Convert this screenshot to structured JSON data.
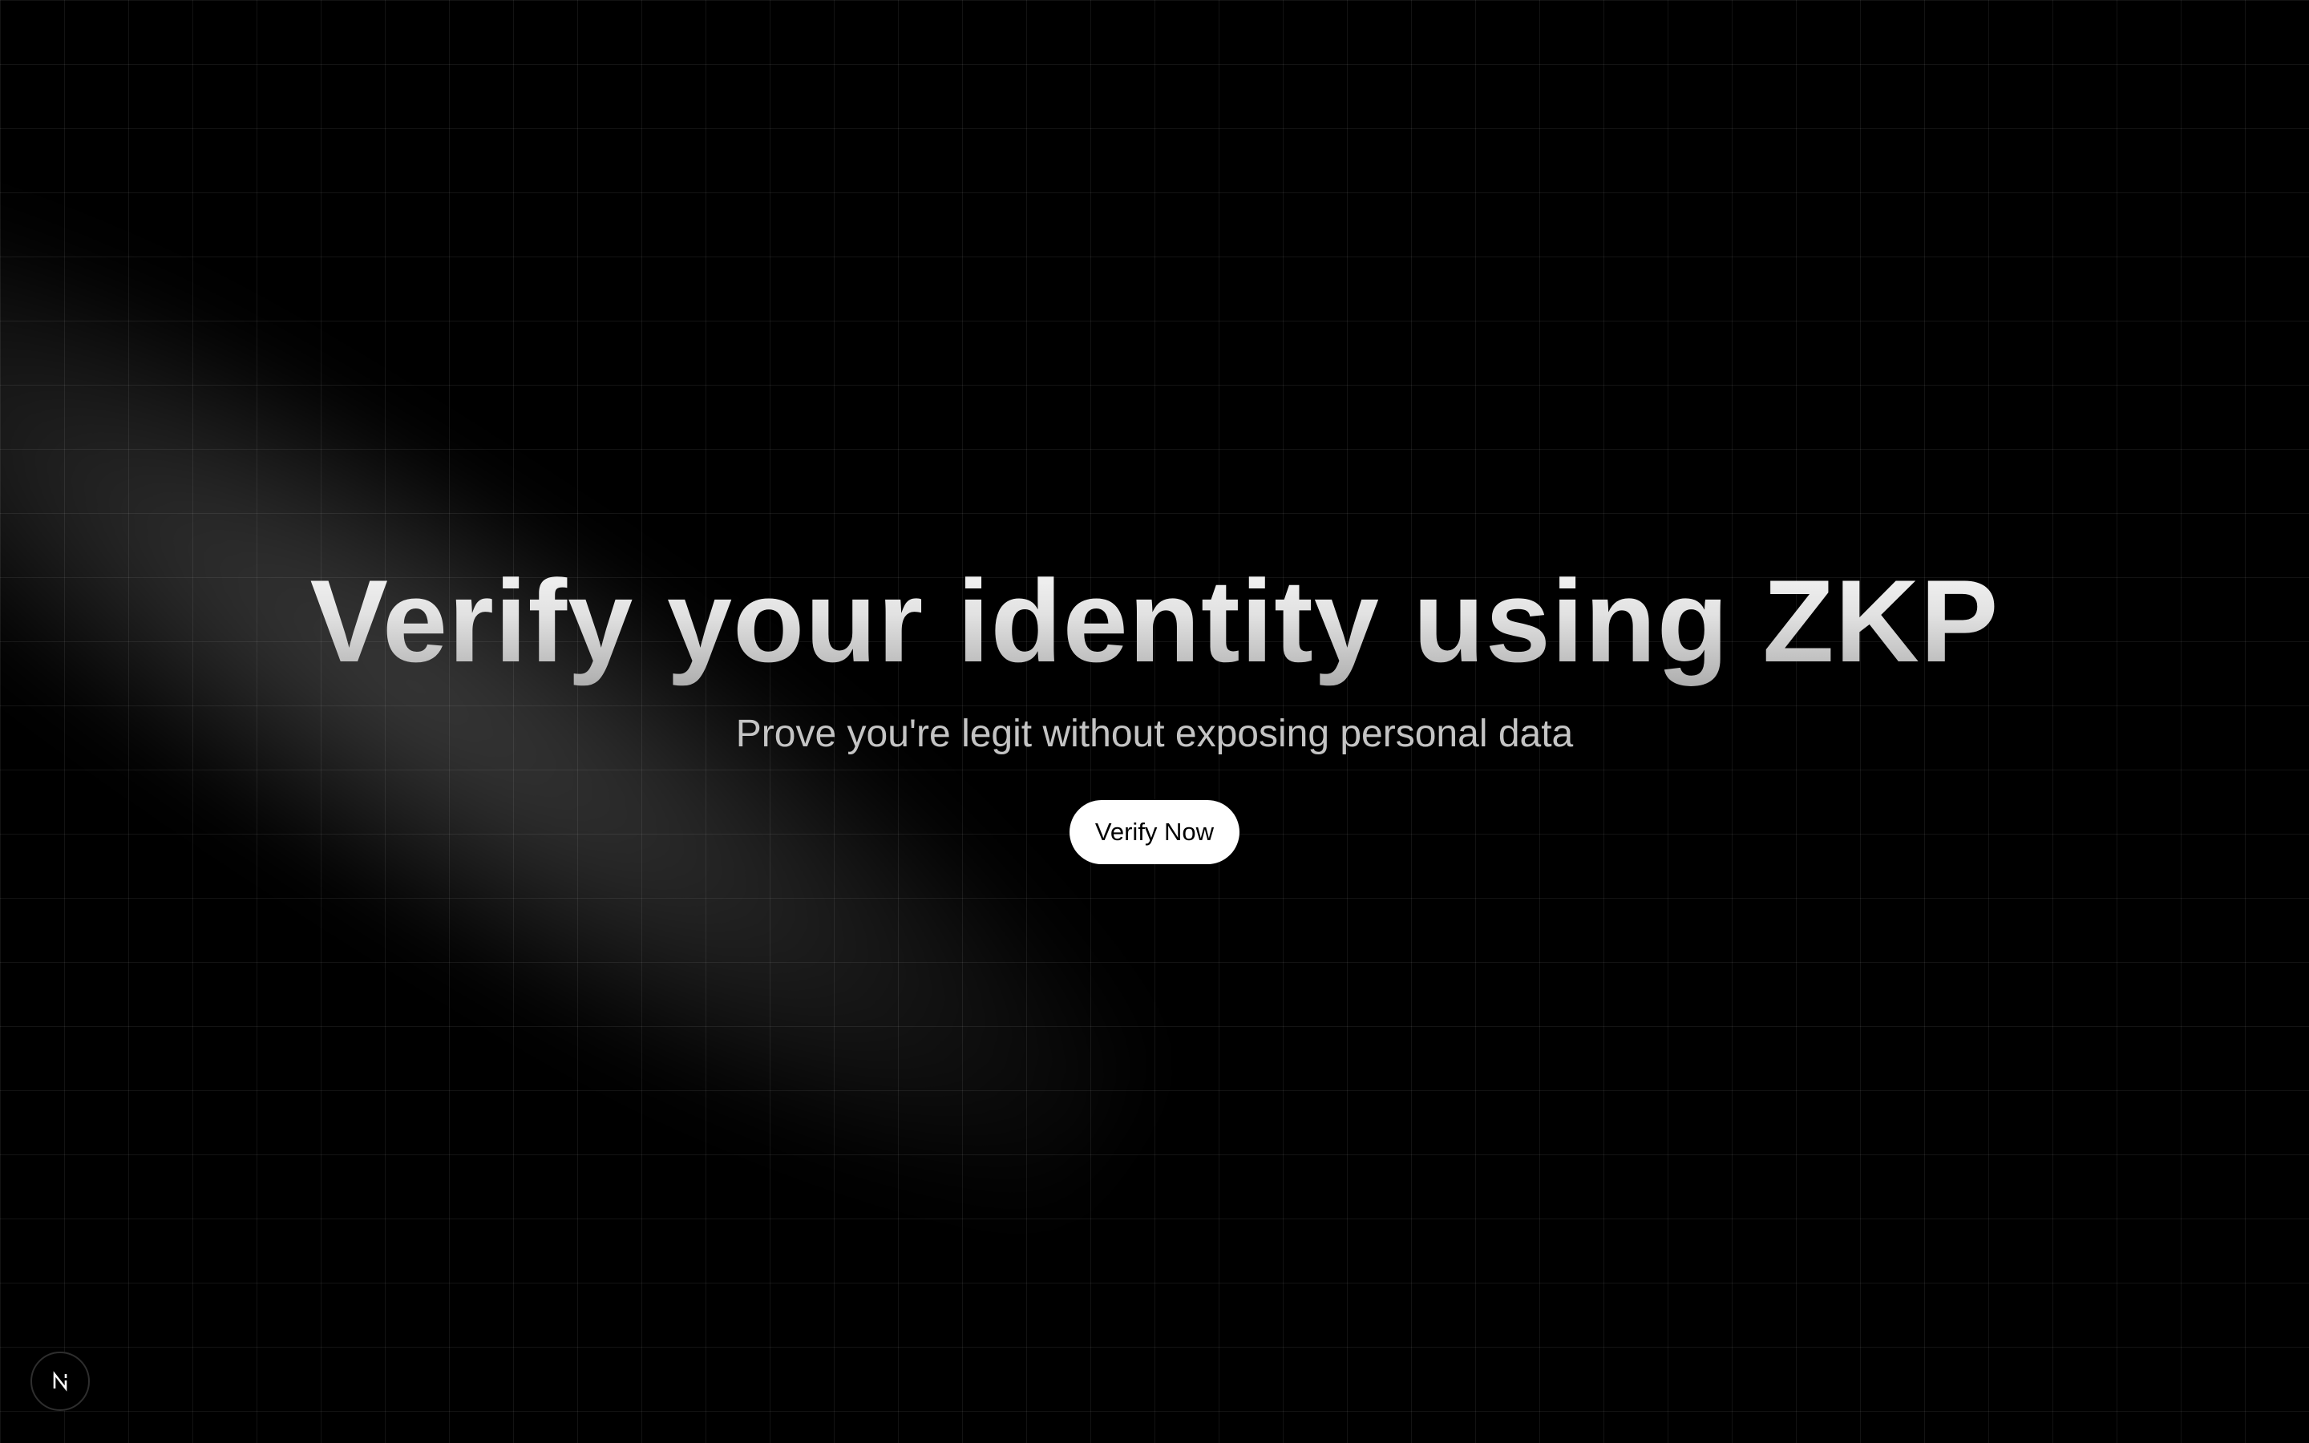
{
  "hero": {
    "title": "Verify your identity using ZKP",
    "subtitle": "Prove you're legit without exposing personal data",
    "cta_label": "Verify Now"
  },
  "dev_badge": {
    "icon": "nextjs-logo-icon",
    "letter": "N"
  },
  "colors": {
    "background": "#000000",
    "button_background": "#ffffff",
    "button_text": "#000000",
    "subtitle": "#c4c4c4"
  }
}
